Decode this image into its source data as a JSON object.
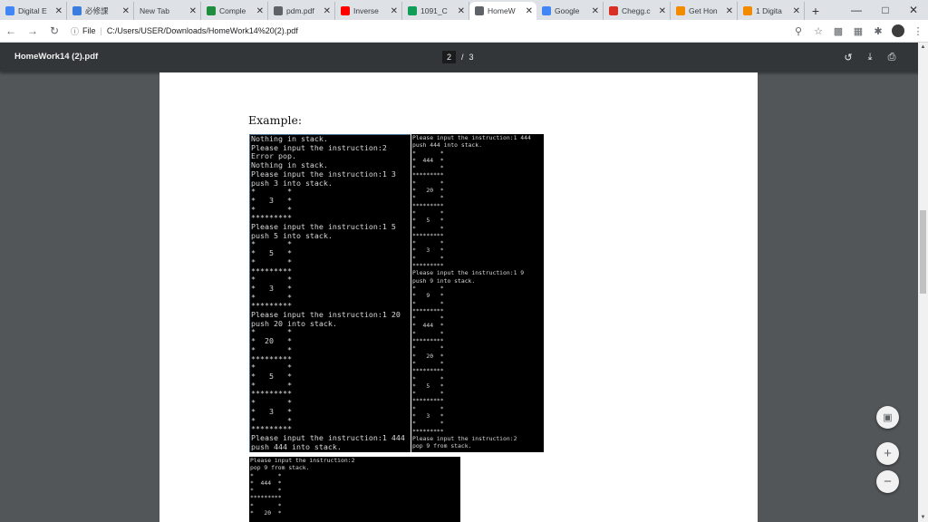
{
  "tabs": [
    {
      "title": "Digital E",
      "icon": "docs-icon",
      "color": "#4285f4"
    },
    {
      "title": "必修課",
      "icon": "people-icon",
      "color": "#3b7ddd"
    },
    {
      "title": "New Tab",
      "icon": "",
      "color": ""
    },
    {
      "title": "Comple",
      "icon": "check-icon",
      "color": "#1e8e3e"
    },
    {
      "title": "pdm.pdf",
      "icon": "globe-icon",
      "color": "#5f6368"
    },
    {
      "title": "Inverse",
      "icon": "youtube-icon",
      "color": "#ff0000"
    },
    {
      "title": "1091_C",
      "icon": "m-icon",
      "color": "#0f9d58"
    },
    {
      "title": "HomeW",
      "icon": "globe-icon",
      "color": "#5f6368",
      "active": true
    },
    {
      "title": "Google",
      "icon": "translate-icon",
      "color": "#4285f4"
    },
    {
      "title": "Chegg.c",
      "icon": "gmail-icon",
      "color": "#d93025"
    },
    {
      "title": "Get Hon",
      "icon": "c-icon",
      "color": "#f38b00"
    },
    {
      "title": "1 Digita",
      "icon": "c-icon",
      "color": "#f38b00"
    }
  ],
  "address": {
    "scheme_label": "File",
    "url": "C:/Users/USER/Downloads/HomeWork14%20(2).pdf"
  },
  "pdf": {
    "title": "HomeWork14 (2).pdf",
    "current_page": "2",
    "separator": "/",
    "total_pages": "3"
  },
  "page_content": {
    "heading": "Example:",
    "console1": "Nothing in stack.\nPlease input the instruction:2\nError pop.\nNothing in stack.\nPlease input the instruction:1 3\npush 3 into stack.\n*       *\n*   3   *\n*       *\n*********\nPlease input the instruction:1 5\npush 5 into stack.\n*       *\n*   5   *\n*       *\n*********\n*       *\n*   3   *\n*       *\n*********\nPlease input the instruction:1 20\npush 20 into stack.\n*       *\n*  20   *\n*       *\n*********\n*       *\n*   5   *\n*       *\n*********\n*       *\n*   3   *\n*       *\n*********\nPlease input the instruction:1 444\npush 444 into stack.",
    "console2": "Please input the instruction:1 444\npush 444 into stack.\n*       *\n*  444  *\n*       *\n*********\n*       *\n*   20  *\n*       *\n*********\n*       *\n*   5   *\n*       *\n*********\n*       *\n*   3   *\n*       *\n*********\nPlease input the instruction:1 9\npush 9 into stack.\n*       *\n*   9   *\n*       *\n*********\n*       *\n*  444  *\n*       *\n*********\n*       *\n*   20  *\n*       *\n*********\n*       *\n*   5   *\n*       *\n*********\n*       *\n*   3   *\n*       *\n*********\nPlease input the instruction:2\npop 9 from stack.",
    "console3": "Please input the instruction:2\npop 9 from stack.\n*       *\n*  444  *\n*       *\n*********\n*       *\n*   20  *"
  }
}
